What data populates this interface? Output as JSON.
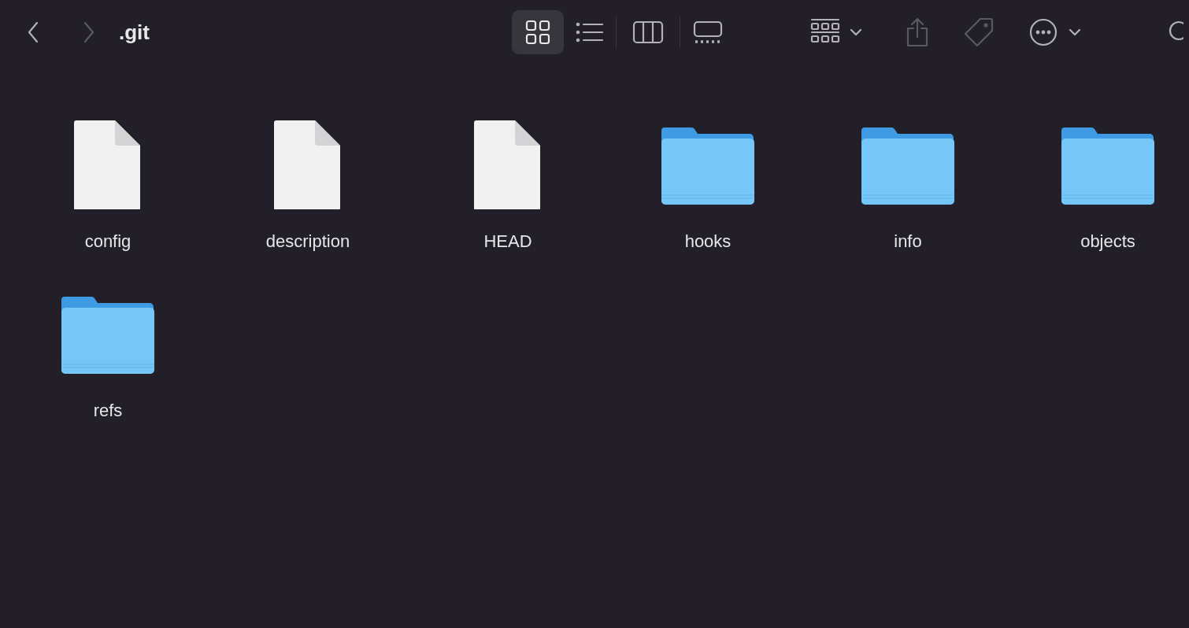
{
  "window": {
    "title": ".git"
  },
  "navigation": {
    "back_disabled": false,
    "forward_disabled": true
  },
  "view_modes": [
    {
      "kind": "icons",
      "selected": true
    },
    {
      "kind": "list",
      "selected": false
    },
    {
      "kind": "columns",
      "selected": false
    },
    {
      "kind": "gallery",
      "selected": false
    }
  ],
  "toolbar": {
    "share_disabled": true,
    "tags_disabled": true
  },
  "items": [
    {
      "kind": "file",
      "name": "config"
    },
    {
      "kind": "file",
      "name": "description"
    },
    {
      "kind": "file",
      "name": "HEAD"
    },
    {
      "kind": "folder",
      "name": "hooks"
    },
    {
      "kind": "folder",
      "name": "info"
    },
    {
      "kind": "folder",
      "name": "objects"
    },
    {
      "kind": "folder",
      "name": "refs"
    }
  ]
}
